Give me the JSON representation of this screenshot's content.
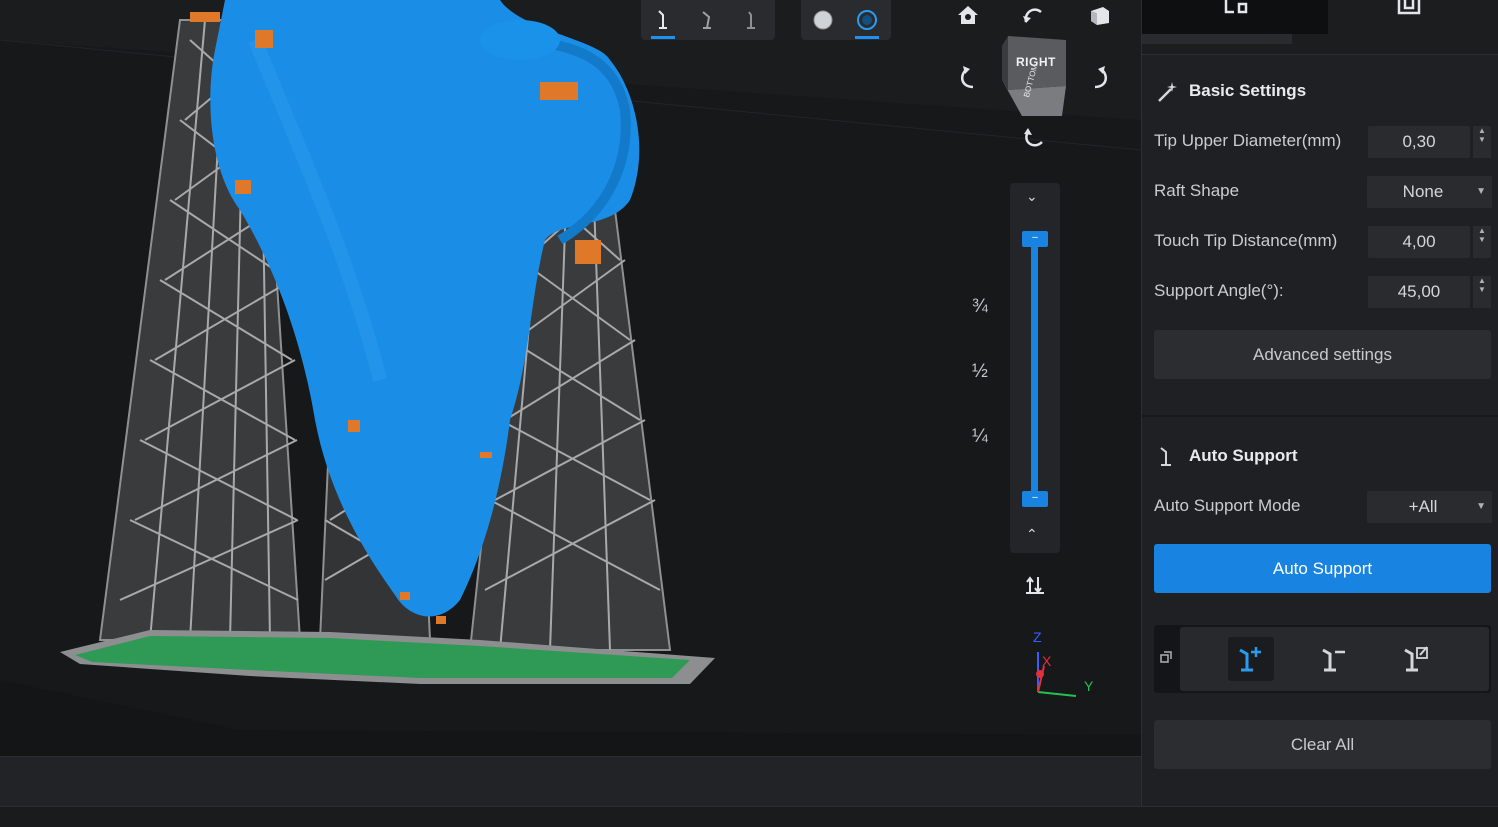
{
  "toolbar": {
    "support_tools": [
      {
        "name": "support-tool-1",
        "active": true
      },
      {
        "name": "support-tool-2",
        "active": false
      },
      {
        "name": "support-tool-3",
        "active": false
      }
    ],
    "render_modes": [
      {
        "name": "solid-render",
        "active": false
      },
      {
        "name": "xray-render",
        "active": true
      }
    ]
  },
  "view_cube": {
    "front_label": "RIGHT",
    "bottom_label": "BOTTOM"
  },
  "slider": {
    "ticks": [
      "¾",
      "½",
      "¼"
    ],
    "upper_handle": "–",
    "lower_handle": "–"
  },
  "axes": {
    "z": "Z",
    "x": "X",
    "y": "Y"
  },
  "panel": {
    "basic_settings": {
      "title": "Basic Settings",
      "tip_upper_diameter_label": "Tip Upper Diameter(mm)",
      "tip_upper_diameter_value": "0,30",
      "raft_shape_label": "Raft Shape",
      "raft_shape_value": "None",
      "touch_tip_distance_label": "Touch Tip Distance(mm)",
      "touch_tip_distance_value": "4,00",
      "support_angle_label": "Support Angle(°):",
      "support_angle_value": "45,00",
      "advanced_button": "Advanced settings"
    },
    "auto_support": {
      "title": "Auto Support",
      "mode_label": "Auto Support Mode",
      "mode_value": "+All",
      "auto_support_button": "Auto Support",
      "clear_all_button": "Clear All"
    }
  },
  "colors": {
    "accent": "#1883e0",
    "model": "#1a8ee6",
    "support": "#9a9b9d",
    "raft": "#2e9a55",
    "contact": "#e0782a"
  }
}
